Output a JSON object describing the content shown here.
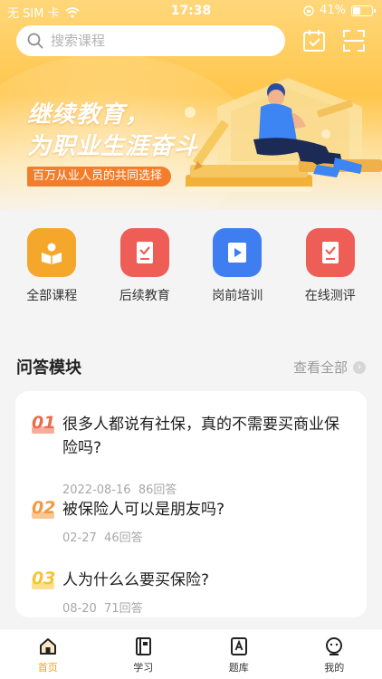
{
  "status_bar": {
    "carrier": "无 SIM 卡",
    "time": "17:38",
    "battery": "41%",
    "battery_level": 0.41
  },
  "search": {
    "placeholder": "搜索课程"
  },
  "header_icons": [
    "calendar-check-icon",
    "scan-icon"
  ],
  "banner": {
    "title_line1": "继续教育，",
    "title_line2": "为职业生涯奋斗",
    "subtitle": "百万从业人员的共同选择"
  },
  "categories": [
    {
      "label": "全部课程",
      "icon": "book-reader-icon",
      "color": "#f5a72c"
    },
    {
      "label": "后续教育",
      "icon": "tablet-check-icon",
      "color": "#ee5e57"
    },
    {
      "label": "岗前培训",
      "icon": "video-play-icon",
      "color": "#3f7ef0"
    },
    {
      "label": "在线测评",
      "icon": "tablet-check-icon",
      "color": "#ee5e57"
    }
  ],
  "qa": {
    "title": "问答模块",
    "view_all": "查看全部",
    "items": [
      {
        "num": "01",
        "question": "很多人都说有社保，真的不需要买商业保险吗?",
        "date": "2022-08-16",
        "answers": "86回答",
        "color": "#ec6b4a"
      },
      {
        "num": "02",
        "question": "被保险人可以是朋友吗?",
        "date": "02-27",
        "answers": "46回答",
        "color": "#f19a3e"
      },
      {
        "num": "03",
        "question": "人为什么么要买保险?",
        "date": "08-20",
        "answers": "71回答",
        "color": "#f5c531"
      }
    ]
  },
  "tabbar": [
    {
      "label": "首页",
      "icon": "home-icon",
      "active": true
    },
    {
      "label": "学习",
      "icon": "notebook-icon",
      "active": false
    },
    {
      "label": "题库",
      "icon": "question-bank-icon",
      "active": false
    },
    {
      "label": "我的",
      "icon": "profile-icon",
      "active": false
    }
  ],
  "colors": {
    "accent": "#f2a218",
    "banner_tag": "#f47d2a"
  }
}
